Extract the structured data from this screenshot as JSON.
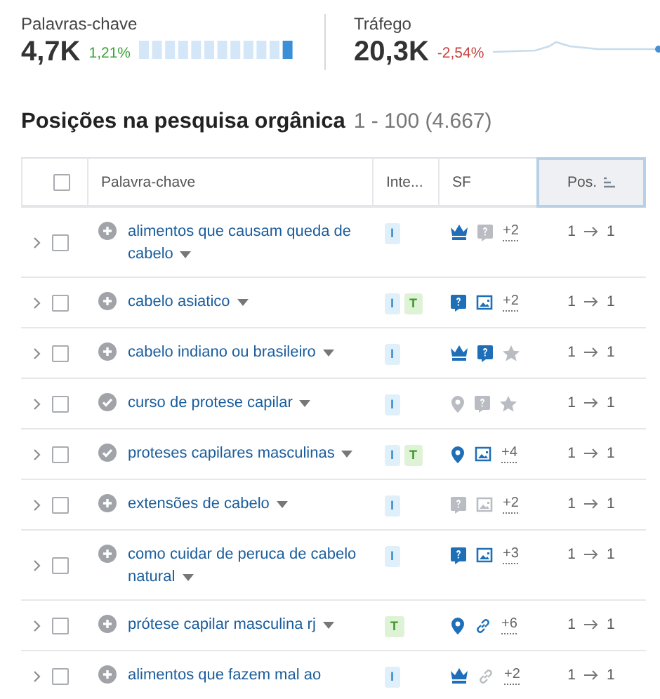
{
  "metrics": [
    {
      "label": "Palavras-chave",
      "value": "4,7K",
      "change": "1,21%",
      "color": "#3aa33a",
      "kind": "bars"
    },
    {
      "label": "Tráfego",
      "value": "20,3K",
      "change": "-2,54%",
      "color": "#c8433e",
      "kind": "sparkline"
    }
  ],
  "section": {
    "title": "Posições na pesquisa orgânica",
    "range": "1 - 100 (4.667)"
  },
  "table": {
    "header_checked": false,
    "columns": [
      {
        "label": "Palavra-chave",
        "selected": false
      },
      {
        "label": "Inte...",
        "selected": false
      },
      {
        "label": "SF",
        "selected": false
      },
      {
        "label": "Pos.",
        "selected": true
      }
    ],
    "rows": [
      {
        "keyword": "alimentos que causam queda de cabelo",
        "caret": true,
        "added": false,
        "checked": false,
        "intents": [
          {
            "label": "I",
            "kind": "informational"
          }
        ],
        "features": [
          {
            "kind": "crown",
            "active": true
          },
          {
            "kind": "question",
            "active": false
          }
        ],
        "more": "+2",
        "from": "1",
        "to": "1"
      },
      {
        "keyword": "cabelo asiatico",
        "caret": true,
        "added": false,
        "checked": false,
        "intents": [
          {
            "label": "I",
            "kind": "informational"
          },
          {
            "label": "T",
            "kind": "transactional"
          }
        ],
        "features": [
          {
            "kind": "question",
            "active": true
          },
          {
            "kind": "image",
            "active": true
          }
        ],
        "more": "+2",
        "from": "1",
        "to": "1"
      },
      {
        "keyword": "cabelo indiano ou brasileiro",
        "caret": true,
        "added": false,
        "checked": false,
        "intents": [
          {
            "label": "I",
            "kind": "informational"
          }
        ],
        "features": [
          {
            "kind": "crown",
            "active": true
          },
          {
            "kind": "question",
            "active": true
          },
          {
            "kind": "star",
            "active": false
          }
        ],
        "from": "1",
        "to": "1"
      },
      {
        "keyword": "curso de protese capilar",
        "caret": true,
        "added": true,
        "checked": false,
        "intents": [
          {
            "label": "I",
            "kind": "informational"
          }
        ],
        "features": [
          {
            "kind": "pin",
            "active": false
          },
          {
            "kind": "question",
            "active": false
          },
          {
            "kind": "star",
            "active": false
          }
        ],
        "from": "1",
        "to": "1"
      },
      {
        "keyword": "proteses capilares masculinas",
        "caret": true,
        "added": true,
        "checked": false,
        "intents": [
          {
            "label": "I",
            "kind": "informational"
          },
          {
            "label": "T",
            "kind": "transactional"
          }
        ],
        "features": [
          {
            "kind": "pin",
            "active": true
          },
          {
            "kind": "image",
            "active": true
          }
        ],
        "more": "+4",
        "from": "1",
        "to": "1"
      },
      {
        "keyword": "extensões de cabelo",
        "caret": true,
        "added": false,
        "checked": false,
        "intents": [
          {
            "label": "I",
            "kind": "informational"
          }
        ],
        "features": [
          {
            "kind": "question",
            "active": false
          },
          {
            "kind": "image",
            "active": false
          }
        ],
        "more": "+2",
        "from": "1",
        "to": "1"
      },
      {
        "keyword": "como cuidar de peruca de cabelo natural",
        "caret": true,
        "added": false,
        "checked": false,
        "intents": [
          {
            "label": "I",
            "kind": "informational"
          }
        ],
        "features": [
          {
            "kind": "question",
            "active": true
          },
          {
            "kind": "image",
            "active": true
          }
        ],
        "more": "+3",
        "from": "1",
        "to": "1"
      },
      {
        "keyword": "prótese capilar masculina rj",
        "caret": true,
        "added": false,
        "checked": false,
        "intents": [
          {
            "label": "T",
            "kind": "transactional"
          }
        ],
        "features": [
          {
            "kind": "pin",
            "active": true
          },
          {
            "kind": "link",
            "active": true
          }
        ],
        "more": "+6",
        "from": "1",
        "to": "1"
      },
      {
        "keyword": "alimentos que fazem mal ao",
        "caret": false,
        "added": false,
        "checked": false,
        "intents": [
          {
            "label": "I",
            "kind": "informational"
          }
        ],
        "features": [
          {
            "kind": "crown",
            "active": true
          },
          {
            "kind": "link",
            "active": false
          }
        ],
        "more": "+2",
        "from": "1",
        "to": "1"
      }
    ]
  }
}
